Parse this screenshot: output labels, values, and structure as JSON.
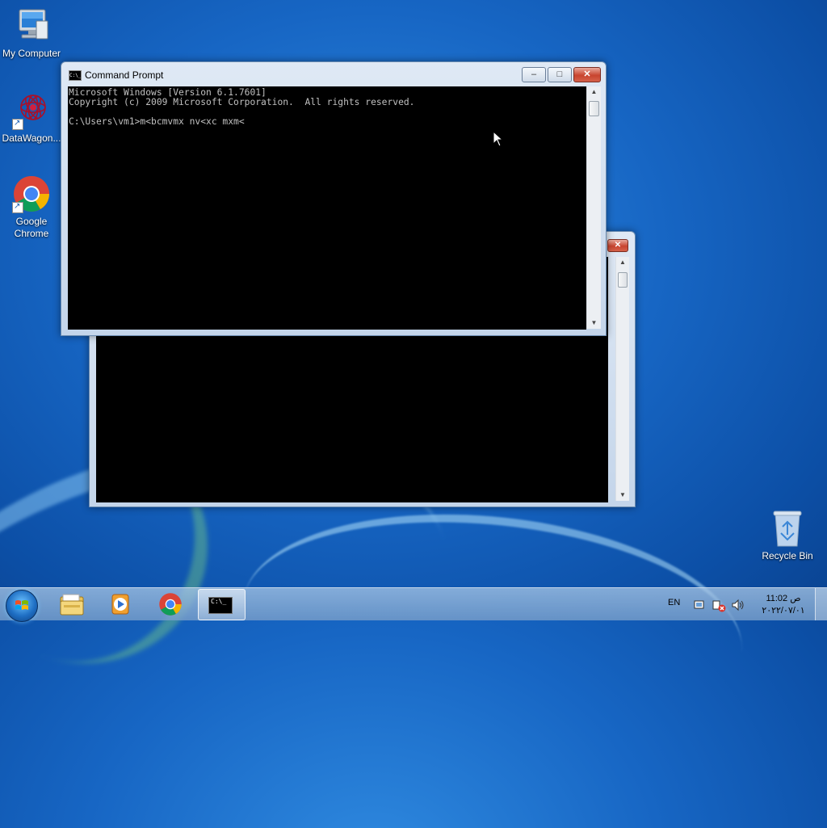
{
  "desktop": {
    "icons": [
      {
        "label": "My Computer",
        "icon": "computer-icon"
      },
      {
        "label": "DataWagon...",
        "icon": "datawagon-icon"
      },
      {
        "label": "Google Chrome",
        "icon": "chrome-icon"
      },
      {
        "label": "Recycle Bin",
        "icon": "recycle-bin-icon"
      }
    ]
  },
  "window_front": {
    "title": "Command Prompt",
    "console_lines": [
      "Microsoft Windows [Version 6.1.7601]",
      "Copyright (c) 2009 Microsoft Corporation.  All rights reserved.",
      "",
      "C:\\Users\\vm1>m<bcmvmx nv<xc mxm<"
    ],
    "buttons": {
      "minimize": "–",
      "maximize": "□",
      "close": "✕"
    }
  },
  "window_back": {
    "buttons": {
      "close": "✕"
    }
  },
  "taskbar": {
    "pinned": [
      {
        "name": "start-button",
        "icon": "windows-logo-icon"
      },
      {
        "name": "explorer",
        "icon": "folder-icon"
      },
      {
        "name": "media-player",
        "icon": "media-player-icon"
      },
      {
        "name": "chrome",
        "icon": "chrome-icon"
      },
      {
        "name": "command-prompt",
        "icon": "cmd-icon",
        "active": true
      }
    ],
    "tray": {
      "language": "EN",
      "time": "11:02 ص",
      "date": "٢٠٢٢/٠٧/٠١"
    }
  }
}
